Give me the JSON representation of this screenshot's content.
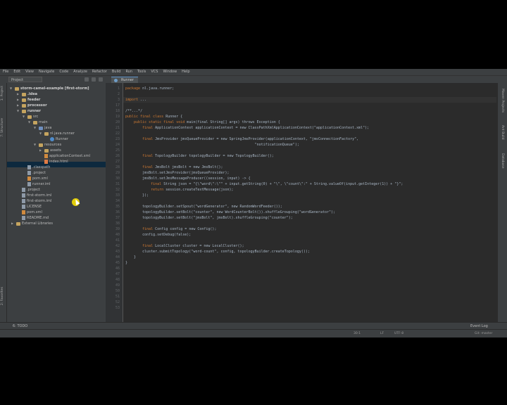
{
  "menu": [
    "File",
    "Edit",
    "View",
    "Navigate",
    "Code",
    "Analyze",
    "Refactor",
    "Build",
    "Run",
    "Tools",
    "VCS",
    "Window",
    "Help"
  ],
  "toolbar": {
    "project_dropdown": "Project"
  },
  "editor_tab": "Runner",
  "left_tabs": {
    "project": "1: Project",
    "structure": "7: Structure",
    "favorites": "2: Favorites"
  },
  "right_tabs": {
    "maven": "Maven Projects",
    "ant": "Ant Build",
    "database": "Database"
  },
  "tree": {
    "root": "storm-camel-example [first-storm]",
    "items": [
      ".idea",
      "feeder",
      "processor",
      "runner",
      "src",
      "main",
      "java",
      "nl.java.runner",
      "Runner",
      "resources",
      "assets",
      "applicationContext.xml",
      "index.html",
      ".classpath",
      ".project",
      "pom.xml",
      "runner.iml",
      ".project",
      "first-storm.iml",
      "first-storm.iml",
      "LICENSE",
      "pom.xml",
      "README.md",
      "External Libraries"
    ]
  },
  "line_numbers": [
    "1",
    "2",
    "3",
    "17",
    "18",
    "19",
    "20",
    "21",
    "22",
    "23",
    "24",
    "25",
    "26",
    "27",
    "28",
    "29",
    "30",
    "31",
    "32",
    "33",
    "34",
    "35",
    "36",
    "37",
    "38",
    "39",
    "40",
    "41",
    "42",
    "43",
    "44",
    "45",
    "46",
    "47",
    "48",
    "49",
    "50",
    "51",
    "52",
    "53"
  ],
  "code": [
    {
      "kw": "package",
      "rest": " nl.java.runner;"
    },
    {
      "kw": "",
      "rest": ""
    },
    {
      "kw": "import",
      "rest": " ..."
    },
    {
      "kw": "",
      "rest": ""
    },
    {
      "kw": "",
      "rest": "/**...*/"
    },
    {
      "kw": "public final class",
      "rest": " Runner {"
    },
    {
      "kw": "    public static final void",
      "rest": " main(final String[] args) throws Exception {"
    },
    {
      "kw": "        final",
      "rest": " ApplicationContext applicationContext = new ClassPathXmlApplicationContext(\"applicationContext.xml\");"
    },
    {
      "kw": "",
      "rest": ""
    },
    {
      "kw": "        final",
      "rest": " JmsProvider jmsQueueProvider = new SpringJmsProvider(applicationContext, \"jmsConnectionFactory\","
    },
    {
      "kw": "",
      "rest": "                                                             \"notificationQueue\");"
    },
    {
      "kw": "",
      "rest": ""
    },
    {
      "kw": "        final",
      "rest": " TopologyBuilder topologyBuilder = new TopologyBuilder();"
    },
    {
      "kw": "",
      "rest": ""
    },
    {
      "kw": "        final",
      "rest": " JmsBolt jmsBolt = new JmsBolt();"
    },
    {
      "kw": "",
      "rest": "        jmsBolt.setJmsProvider(jmsQueueProvider);"
    },
    {
      "kw": "",
      "rest": "        jmsBolt.setJmsMessageProducer((session, input) -> {"
    },
    {
      "kw": "            final",
      "rest": " String json = \"{\\\"word\\\":\\\"\" + input.getString(0) + \"\\\", \\\"count\\\":\" + String.valueOf(input.getInteger(1)) + \"}\";"
    },
    {
      "kw": "            return",
      "rest": " session.createTextMessage(json);"
    },
    {
      "kw": "",
      "rest": "        });"
    },
    {
      "kw": "",
      "rest": ""
    },
    {
      "kw": "",
      "rest": "        topologyBuilder.setSpout(\"wordGenerator\", new RandomWordFeeder());"
    },
    {
      "kw": "",
      "rest": "        topologyBuilder.setBolt(\"counter\", new WordCounterBolt()).shuffleGrouping(\"wordGenerator\");"
    },
    {
      "kw": "",
      "rest": "        topologyBuilder.setBolt(\"jmsBolt\", jmsBolt).shuffleGrouping(\"counter\");"
    },
    {
      "kw": "",
      "rest": ""
    },
    {
      "kw": "        final",
      "rest": " Config config = new Config();"
    },
    {
      "kw": "",
      "rest": "        config.setDebug(false);"
    },
    {
      "kw": "",
      "rest": ""
    },
    {
      "kw": "        final",
      "rest": " LocalCluster cluster = new LocalCluster();"
    },
    {
      "kw": "",
      "rest": "        cluster.submitTopology(\"word-count\", config, topologyBuilder.createTopology());"
    },
    {
      "kw": "",
      "rest": "    }"
    },
    {
      "kw": "",
      "rest": "}"
    }
  ],
  "bottom": {
    "todo": "6: TODO",
    "event_log": "Event Log"
  },
  "status": {
    "position": "30:1",
    "line_sep": "LF",
    "encoding": "UTF-8",
    "vcs": "Git: master"
  }
}
